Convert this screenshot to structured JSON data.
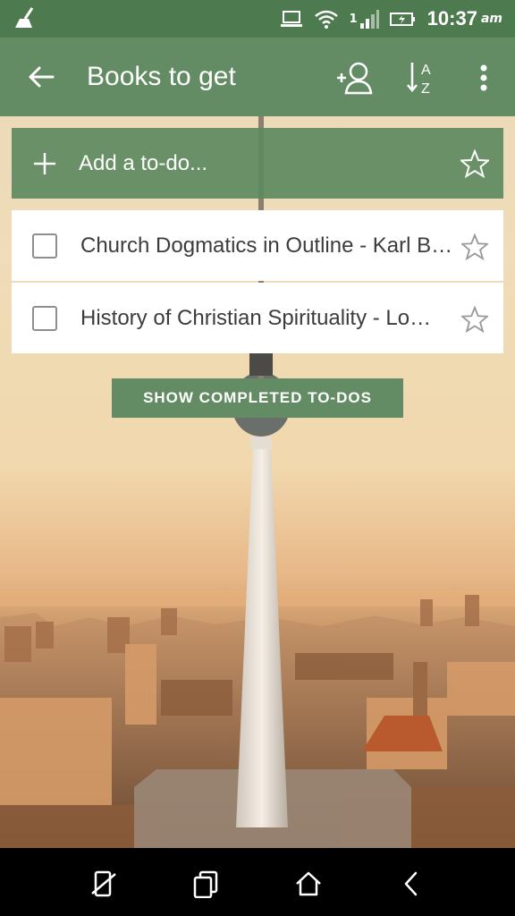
{
  "status_bar": {
    "time": "10:37",
    "ampm": "am",
    "icons": [
      "cleaner-icon",
      "laptop-icon",
      "wifi-icon",
      "signal-icon",
      "battery-charging-icon"
    ],
    "signal_label": "1"
  },
  "app_bar": {
    "title": "Books to get",
    "back_icon": "arrow-left-icon",
    "actions": [
      "add-member-icon",
      "sort-az-icon",
      "more-vert-icon"
    ]
  },
  "add_bar": {
    "placeholder": "Add a to-do..."
  },
  "todos": [
    {
      "text": "Church Dogmatics in Outline - Karl Barth",
      "checked": false,
      "starred": false
    },
    {
      "text": "History of Christian Spirituality - Lo…",
      "checked": false,
      "starred": false
    }
  ],
  "show_completed_label": "SHOW COMPLETED TO-DOS",
  "nav_bar": {
    "icons": [
      "rotate-icon",
      "recents-icon",
      "home-icon",
      "back-icon"
    ]
  },
  "colors": {
    "status_bar": "#4e7a50",
    "app_bar": "#648c64",
    "add_bar": "#5d8a60",
    "button": "#648c64"
  }
}
